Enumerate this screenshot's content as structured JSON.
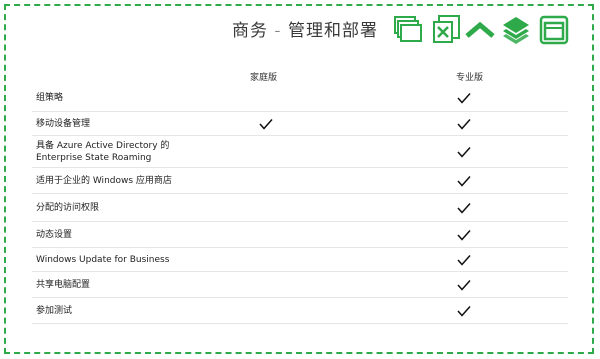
{
  "header": {
    "title": "商务 - 管理和部署",
    "icons": [
      "windows-stack-icon",
      "excel-close-icon",
      "chevron-up-icon",
      "layers-icon",
      "app-window-icon"
    ]
  },
  "columns": {
    "home": "家庭版",
    "pro": "专业版"
  },
  "rows": [
    {
      "label": "组策略",
      "home": false,
      "pro": true
    },
    {
      "label": "移动设备管理",
      "home": true,
      "pro": true
    },
    {
      "label": "具备 Azure Active Directory 的\nEnterprise State Roaming",
      "home": false,
      "pro": true
    },
    {
      "label": "适用于企业的 Windows 应用商店",
      "home": false,
      "pro": true
    },
    {
      "label": "分配的访问权限",
      "home": false,
      "pro": true
    },
    {
      "label": "动态设置",
      "home": false,
      "pro": true
    },
    {
      "label": "Windows Update for Business",
      "home": false,
      "pro": true
    },
    {
      "label": "共享电脑配置",
      "home": false,
      "pro": true
    },
    {
      "label": "参加测试",
      "home": false,
      "pro": true
    }
  ],
  "colors": {
    "accent": "#2eaa4a",
    "divider": "#e6e6e6",
    "text": "#222222"
  }
}
